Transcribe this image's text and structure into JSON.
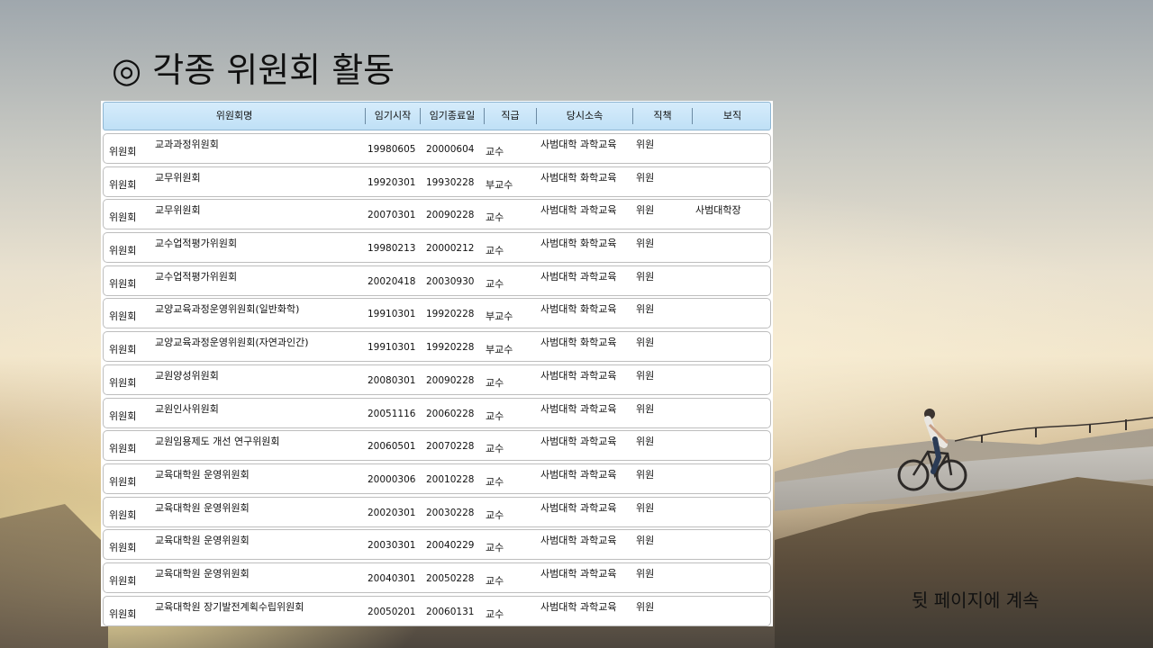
{
  "slide": {
    "title": "◎ 각종 위원회 활동",
    "continue_note": "뒷 페이지에 계속"
  },
  "table": {
    "headers": {
      "committee_name": "위원회명",
      "term_start": "임기시작",
      "term_end": "임기종료일",
      "rank": "직급",
      "affiliation": "당시소속",
      "duty": "직책",
      "position": "보직"
    },
    "rows": [
      {
        "type": "위원회",
        "name": "교과과정위원회",
        "start": "19980605",
        "end": "20000604",
        "rank": "교수",
        "dept": "사범대학 과학교육",
        "role": "위원",
        "post": ""
      },
      {
        "type": "위원회",
        "name": "교무위원회",
        "start": "19920301",
        "end": "19930228",
        "rank": "부교수",
        "dept": "사범대학 화학교육",
        "role": "위원",
        "post": ""
      },
      {
        "type": "위원회",
        "name": "교무위원회",
        "start": "20070301",
        "end": "20090228",
        "rank": "교수",
        "dept": "사범대학 과학교육",
        "role": "위원",
        "post": "사범대학장"
      },
      {
        "type": "위원회",
        "name": "교수업적평가위원회",
        "start": "19980213",
        "end": "20000212",
        "rank": "교수",
        "dept": "사범대학 화학교육",
        "role": "위원",
        "post": ""
      },
      {
        "type": "위원회",
        "name": "교수업적평가위원회",
        "start": "20020418",
        "end": "20030930",
        "rank": "교수",
        "dept": "사범대학 과학교육",
        "role": "위원",
        "post": ""
      },
      {
        "type": "위원회",
        "name": "교양교육과정운영위원회(일반화학)",
        "start": "19910301",
        "end": "19920228",
        "rank": "부교수",
        "dept": "사범대학 화학교육",
        "role": "위원",
        "post": ""
      },
      {
        "type": "위원회",
        "name": "교양교육과정운영위원회(자연과인간)",
        "start": "19910301",
        "end": "19920228",
        "rank": "부교수",
        "dept": "사범대학 화학교육",
        "role": "위원",
        "post": ""
      },
      {
        "type": "위원회",
        "name": "교원양성위원회",
        "start": "20080301",
        "end": "20090228",
        "rank": "교수",
        "dept": "사범대학 과학교육",
        "role": "위원",
        "post": ""
      },
      {
        "type": "위원회",
        "name": "교원인사위원회",
        "start": "20051116",
        "end": "20060228",
        "rank": "교수",
        "dept": "사범대학 과학교육",
        "role": "위원",
        "post": ""
      },
      {
        "type": "위원회",
        "name": "교원임용제도 개선 연구위원회",
        "start": "20060501",
        "end": "20070228",
        "rank": "교수",
        "dept": "사범대학 과학교육",
        "role": "위원",
        "post": ""
      },
      {
        "type": "위원회",
        "name": "교육대학원 운영위원회",
        "start": "20000306",
        "end": "20010228",
        "rank": "교수",
        "dept": "사범대학 과학교육",
        "role": "위원",
        "post": ""
      },
      {
        "type": "위원회",
        "name": "교육대학원 운영위원회",
        "start": "20020301",
        "end": "20030228",
        "rank": "교수",
        "dept": "사범대학 과학교육",
        "role": "위원",
        "post": ""
      },
      {
        "type": "위원회",
        "name": "교육대학원 운영위원회",
        "start": "20030301",
        "end": "20040229",
        "rank": "교수",
        "dept": "사범대학 과학교육",
        "role": "위원",
        "post": ""
      },
      {
        "type": "위원회",
        "name": "교육대학원 운영위원회",
        "start": "20040301",
        "end": "20050228",
        "rank": "교수",
        "dept": "사범대학 과학교육",
        "role": "위원",
        "post": ""
      },
      {
        "type": "위원회",
        "name": "교육대학원 장기발전계획수립위원회",
        "start": "20050201",
        "end": "20060131",
        "rank": "교수",
        "dept": "사범대학 과학교육",
        "role": "위원",
        "post": ""
      }
    ]
  }
}
